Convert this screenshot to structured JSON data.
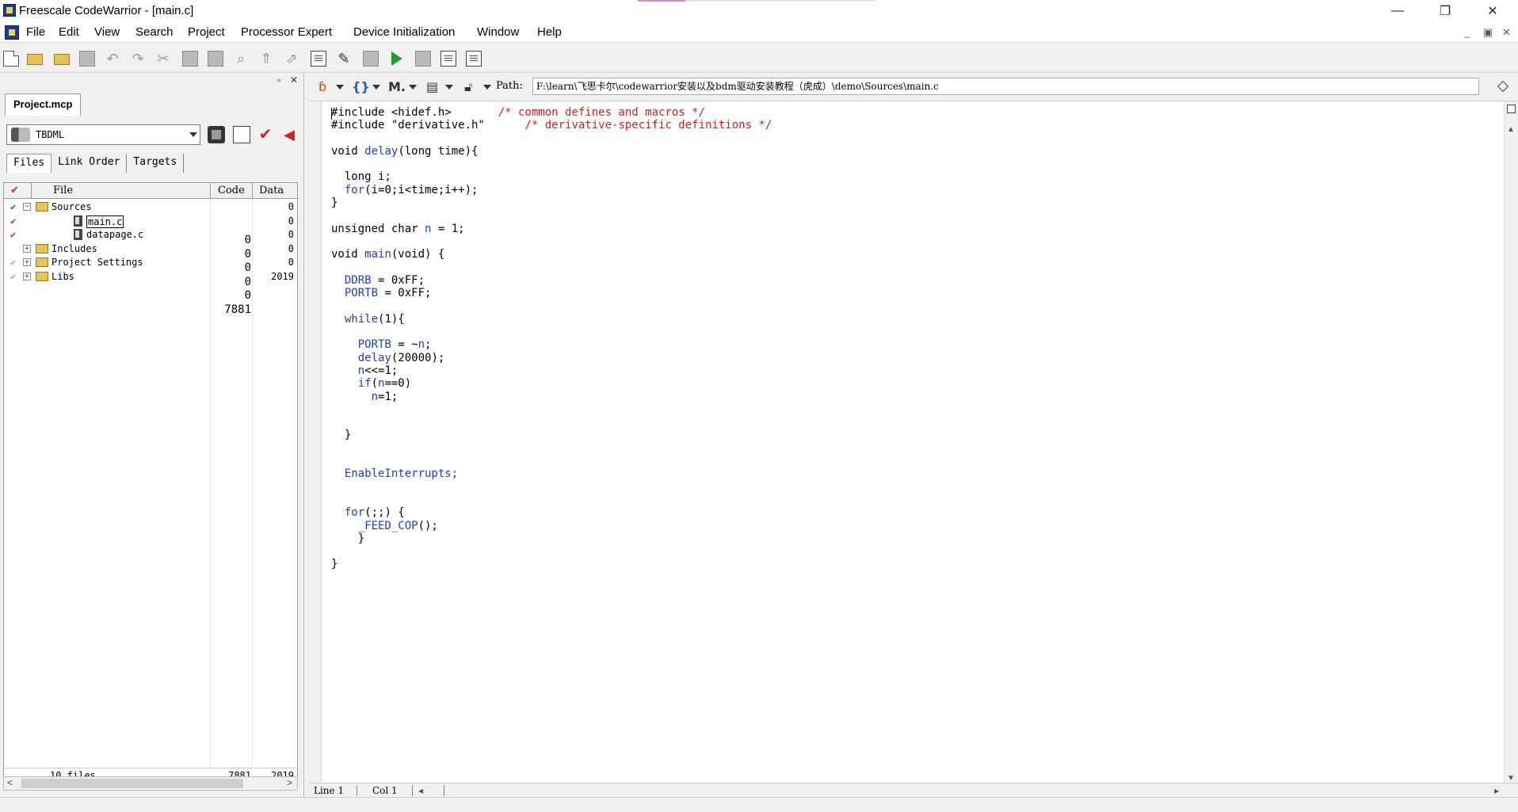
{
  "window": {
    "title": "Freescale CodeWarrior - [main.c]",
    "controls": {
      "minimize": "—",
      "restore": "❐",
      "close": "✕"
    }
  },
  "menu": {
    "items": [
      "File",
      "Edit",
      "View",
      "Search",
      "Project",
      "Processor Expert",
      "Device Initialization",
      "Window",
      "Help"
    ],
    "mdi_controls": {
      "minimize": "_",
      "restore": "▣",
      "close": "✕"
    }
  },
  "toolbar": {
    "icons": [
      "new-file-icon",
      "new-project-icon",
      "open-icon",
      "save-icon",
      "undo-icon",
      "redo-icon",
      "cut-icon",
      "copy-icon",
      "paste-icon",
      "find-icon",
      "find-next-icon",
      "replace-icon",
      "compile-icon",
      "make-icon",
      "remove-objects-icon",
      "debug-run-icon",
      "stop-icon",
      "project-settings-icon",
      "target-settings-icon"
    ]
  },
  "project_pane": {
    "controls": {
      "pin": "▫",
      "close": "✕"
    },
    "tab_label": "Project.mcp",
    "target": "TBDML",
    "file_tabs": [
      "Files",
      "Link Order",
      "Targets"
    ],
    "columns": {
      "file": "File",
      "code": "Code",
      "data": "Data"
    },
    "rows": [
      {
        "name": "Sources",
        "code": "0",
        "data": "0",
        "type": "folder",
        "expanded": true,
        "check": "✔",
        "indent": 0
      },
      {
        "name": "main.c",
        "code": "0",
        "data": "0",
        "type": "file",
        "selected": true,
        "check": "✔",
        "indent": 1
      },
      {
        "name": "datapage.c",
        "code": "0",
        "data": "0",
        "type": "file",
        "check": "✔",
        "indent": 1
      },
      {
        "name": "Includes",
        "code": "0",
        "data": "0",
        "type": "folder",
        "expanded": false,
        "check": "",
        "indent": 0
      },
      {
        "name": "Project Settings",
        "code": "0",
        "data": "0",
        "type": "folder",
        "expanded": false,
        "check": "✔",
        "indent": 0
      },
      {
        "name": "Libs",
        "code": "7881",
        "data": "2019",
        "type": "folder",
        "expanded": false,
        "check": "✔",
        "indent": 0
      }
    ],
    "footer": {
      "files": "10 files",
      "code": "7881",
      "data": "2019"
    }
  },
  "editor": {
    "path_label": "Path:",
    "path": "F:\\learn\\飞思卡尔\\codewarrior安装以及bdm驱动安装教程（虎成）\\demo\\Sources\\main.c",
    "code_lines": [
      [
        {
          "t": "#include <hidef.h>       "
        },
        {
          "t": "/* common defines and macros */",
          "c": "c-red"
        }
      ],
      [
        {
          "t": "#include \"derivative.h\"      "
        },
        {
          "t": "/* derivative-specific definitions */",
          "c": "c-red"
        }
      ],
      [
        {
          "t": ""
        }
      ],
      [
        {
          "t": "void "
        },
        {
          "t": "delay",
          "c": "kw-blue"
        },
        {
          "t": "(long time){"
        }
      ],
      [
        {
          "t": ""
        }
      ],
      [
        {
          "t": "  long i;"
        }
      ],
      [
        {
          "t": "  "
        },
        {
          "t": "for",
          "c": "kw-blue"
        },
        {
          "t": "(i=0;i<time;i++);"
        }
      ],
      [
        {
          "t": "}"
        }
      ],
      [
        {
          "t": ""
        }
      ],
      [
        {
          "t": "unsigned char "
        },
        {
          "t": "n",
          "c": "kw-blue"
        },
        {
          "t": " = 1;"
        }
      ],
      [
        {
          "t": ""
        }
      ],
      [
        {
          "t": "void "
        },
        {
          "t": "main",
          "c": "kw-blue"
        },
        {
          "t": "(void) {"
        }
      ],
      [
        {
          "t": ""
        }
      ],
      [
        {
          "t": "  "
        },
        {
          "t": "DDRB",
          "c": "kw-blue"
        },
        {
          "t": " = 0xFF;"
        }
      ],
      [
        {
          "t": "  "
        },
        {
          "t": "PORTB",
          "c": "kw-blue"
        },
        {
          "t": " = 0xFF;"
        }
      ],
      [
        {
          "t": ""
        }
      ],
      [
        {
          "t": "  "
        },
        {
          "t": "while",
          "c": "kw-blue"
        },
        {
          "t": "(1){"
        }
      ],
      [
        {
          "t": ""
        }
      ],
      [
        {
          "t": "    "
        },
        {
          "t": "PORTB",
          "c": "kw-blue"
        },
        {
          "t": " = ~"
        },
        {
          "t": "n",
          "c": "kw-blue"
        },
        {
          "t": ";"
        }
      ],
      [
        {
          "t": "    "
        },
        {
          "t": "delay",
          "c": "kw-blue"
        },
        {
          "t": "(20000);"
        }
      ],
      [
        {
          "t": "    "
        },
        {
          "t": "n",
          "c": "kw-blue"
        },
        {
          "t": "<<=1;"
        }
      ],
      [
        {
          "t": "    "
        },
        {
          "t": "if",
          "c": "kw-blue"
        },
        {
          "t": "("
        },
        {
          "t": "n",
          "c": "kw-blue"
        },
        {
          "t": "==0)"
        }
      ],
      [
        {
          "t": "      "
        },
        {
          "t": "n",
          "c": "kw-blue"
        },
        {
          "t": "=1;"
        }
      ],
      [
        {
          "t": ""
        }
      ],
      [
        {
          "t": ""
        }
      ],
      [
        {
          "t": "  }"
        }
      ],
      [
        {
          "t": ""
        }
      ],
      [
        {
          "t": ""
        }
      ],
      [
        {
          "t": "  "
        },
        {
          "t": "EnableInterrupts;",
          "c": "kw-blue"
        }
      ],
      [
        {
          "t": ""
        }
      ],
      [
        {
          "t": ""
        }
      ],
      [
        {
          "t": "  "
        },
        {
          "t": "for",
          "c": "kw-blue"
        },
        {
          "t": "(;;) {"
        }
      ],
      [
        {
          "t": "    "
        },
        {
          "t": "_FEED_COP",
          "c": "kw-blue"
        },
        {
          "t": "();"
        }
      ],
      [
        {
          "t": "    }"
        }
      ],
      [
        {
          "t": ""
        }
      ],
      [
        {
          "t": "}"
        }
      ]
    ],
    "status": {
      "line": "Line 1",
      "col": "Col 1"
    }
  },
  "colors": {
    "keyword": "#1f3fbf",
    "comment": "#d41c1c",
    "check": "#c42626",
    "folder": "#e6c25a"
  }
}
